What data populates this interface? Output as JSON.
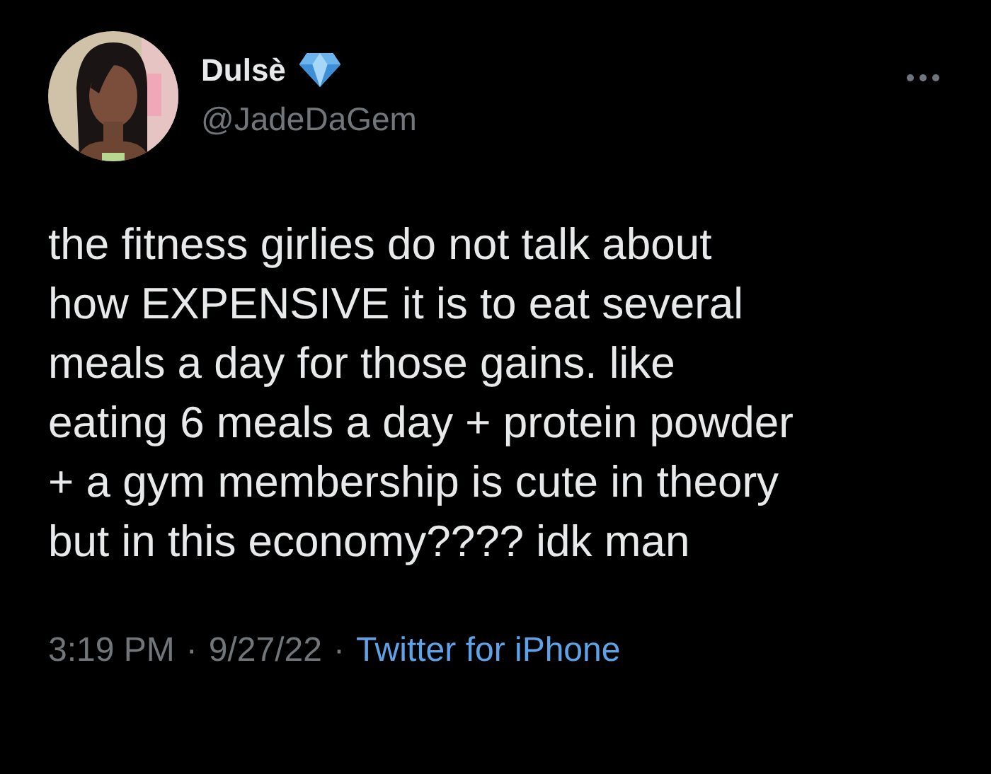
{
  "tweet": {
    "author": {
      "name": "Dulsè",
      "handle": "@JadeDaGem"
    },
    "text": "the fitness girlies do not talk about\nhow EXPENSIVE it is to eat several\nmeals a day for those gains. like\neating 6 meals a day + protein powder\n+ a gym membership is cute in theory\nbut in this economy???? idk man",
    "time": "3:19 PM",
    "separator_1": "·",
    "date": "9/27/22",
    "separator_2": "·",
    "source": "Twitter for iPhone"
  }
}
